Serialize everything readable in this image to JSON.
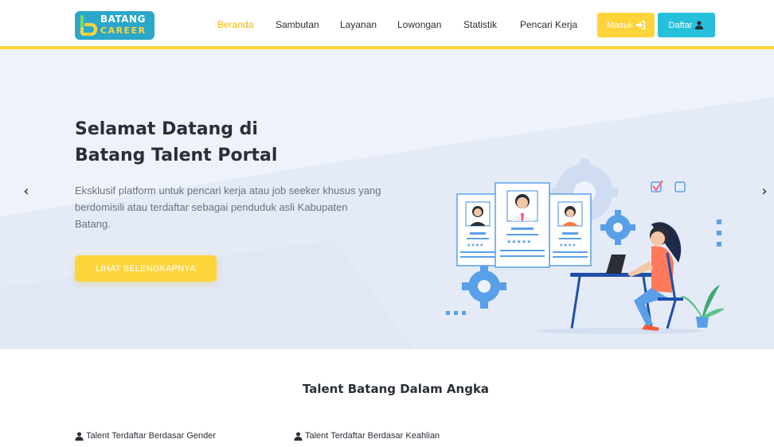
{
  "brand": {
    "line1": "BATANG",
    "line2": "CAREER"
  },
  "nav": {
    "items": [
      {
        "label": "Beranda",
        "active": true
      },
      {
        "label": "Sambutan",
        "active": false
      },
      {
        "label": "Layanan",
        "active": false
      },
      {
        "label": "Lowongan",
        "active": false
      },
      {
        "label": "Statistik",
        "active": false
      },
      {
        "label": "Pencari Kerja",
        "active": false
      }
    ],
    "login_label": "Masuk",
    "register_label": "Daftar"
  },
  "hero": {
    "title_line1": "Selamat Datang di",
    "title_line2": "Batang Talent Portal",
    "desc_line1": "Eksklusif platform untuk pencari kerja atau job seeker khusus yang",
    "desc_line2": "berdomisili atau terdaftar sebagai penduduk asli Kabupaten",
    "desc_line3": "Batang.",
    "cta_label": "LIHAT SELENGKAPNYA",
    "prev_glyph": "‹",
    "next_glyph": "›"
  },
  "stats": {
    "title": "Talent Batang Dalam Angka",
    "gender_label": "Talent Terdaftar Berdasar Gender",
    "skill_label": "Talent Terdaftar Berdasar Keahlian"
  },
  "colors": {
    "accent_yellow": "#ffd43b",
    "accent_cyan": "#26c0dc",
    "active_nav": "#f6b400",
    "hero_bg": "#eef3fb",
    "text_dark": "#2a2f36",
    "text_muted": "#6b7280"
  },
  "icons": {
    "login": "sign-in-icon",
    "register": "user-icon",
    "prev": "chevron-left-icon",
    "next": "chevron-right-icon",
    "stat": "user-icon"
  }
}
